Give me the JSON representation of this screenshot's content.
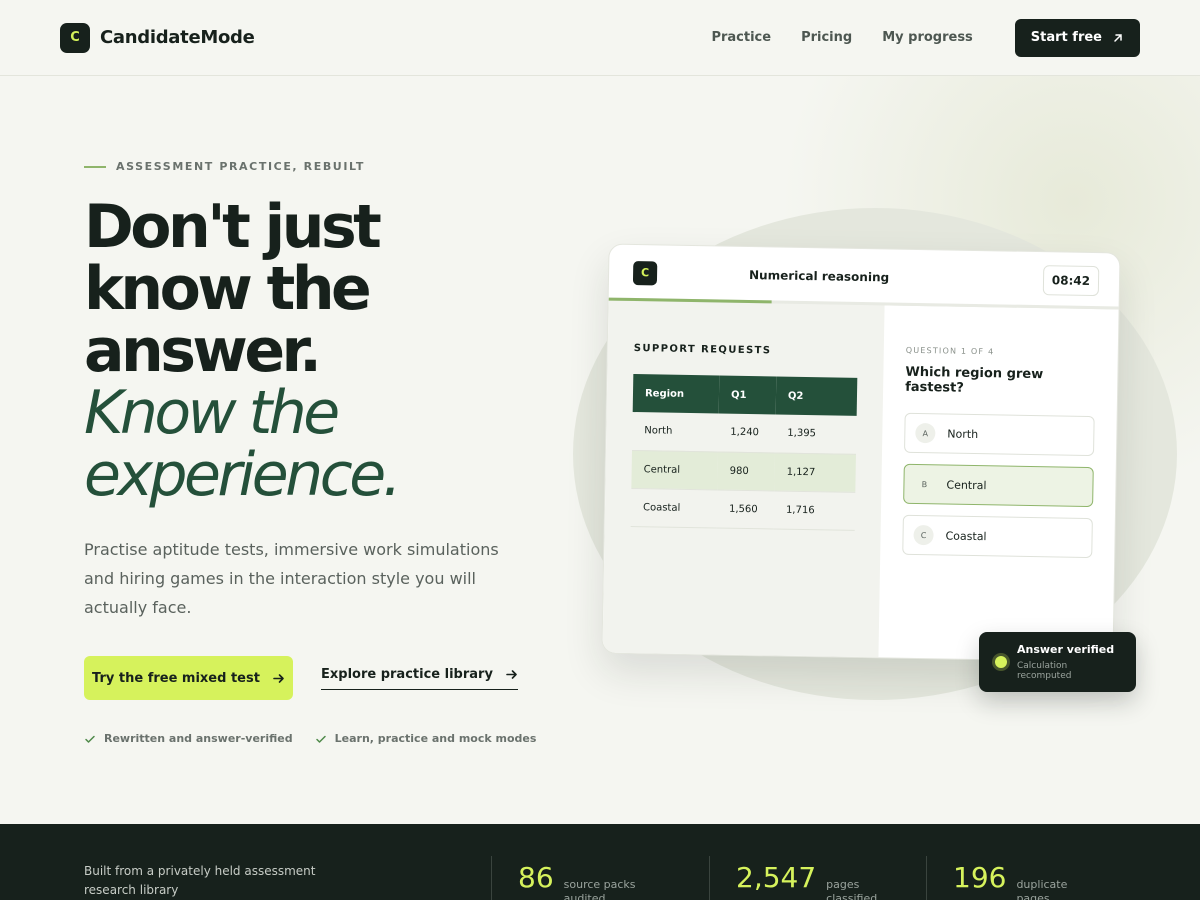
{
  "header": {
    "brand_initial": "C",
    "brand_name": "CandidateMode",
    "nav": [
      {
        "label": "Practice"
      },
      {
        "label": "Pricing"
      },
      {
        "label": "My progress"
      }
    ],
    "cta_label": "Start free",
    "cta_icon": "arrow-up-right-icon"
  },
  "hero": {
    "eyebrow": "ASSESSMENT PRACTICE, REBUILT",
    "headline_lines": [
      "Don't just",
      "know the",
      "answer."
    ],
    "headline_italic_lines": [
      "Know the",
      "experience."
    ],
    "subtext": "Practise aptitude tests, immersive work simulations and hiring games in the interaction style you will actually face.",
    "primary_cta": "Try the free mixed test",
    "secondary_cta": "Explore practice library",
    "badges": [
      "Rewritten and answer-verified",
      "Learn, practice and mock modes"
    ]
  },
  "mockup": {
    "logo_initial": "C",
    "title": "Numerical reasoning",
    "timer": "08:42",
    "progress_fraction": 0.32,
    "table_title": "SUPPORT REQUESTS",
    "table_headers": [
      "Region",
      "Q1",
      "Q2"
    ],
    "table_rows": [
      [
        "North",
        "1,240",
        "1,395"
      ],
      [
        "Central",
        "980",
        "1,127"
      ],
      [
        "Coastal",
        "1,560",
        "1,716"
      ]
    ],
    "highlighted_row": 1,
    "question_counter": "QUESTION 1 OF 4",
    "question": "Which region grew fastest?",
    "options": [
      {
        "letter": "A",
        "label": "North"
      },
      {
        "letter": "B",
        "label": "Central"
      },
      {
        "letter": "C",
        "label": "Coastal"
      }
    ],
    "selected_option": 1
  },
  "toast": {
    "title": "Answer verified",
    "subtitle": "Calculation recomputed"
  },
  "stats": {
    "intro": "Built from a privately held assessment research library",
    "items": [
      {
        "value": "86",
        "label": "source packs audited"
      },
      {
        "value": "2,547",
        "label": "pages classified"
      },
      {
        "value": "196",
        "label": "duplicate pages skipped"
      }
    ]
  },
  "colors": {
    "accent_lime": "#d6f25c",
    "dark": "#17211c",
    "forest": "#24503a",
    "sage": "#8fb56b",
    "background": "#f5f6f1"
  }
}
